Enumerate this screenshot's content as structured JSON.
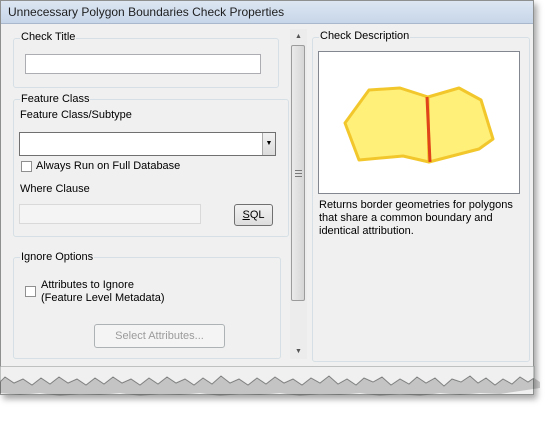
{
  "window": {
    "title": "Unnecessary Polygon Boundaries Check Properties"
  },
  "check_title": {
    "label": "Check Title",
    "value": ""
  },
  "feature_class": {
    "group_label": "Feature Class",
    "subtype_label": "Feature Class/Subtype",
    "selected": "",
    "dropdown_icon": "chevron-down-icon",
    "always_run_label": "Always Run on Full Database",
    "always_run_checked": false,
    "where_label": "Where Clause",
    "where_value": "",
    "sql_button": "SQL"
  },
  "ignore_options": {
    "group_label": "Ignore Options",
    "attributes_label_line1": "Attributes to Ignore",
    "attributes_label_line2": "(Feature Level Metadata)",
    "attributes_checked": false,
    "select_button": "Select Attributes..."
  },
  "description": {
    "group_label": "Check Description",
    "text": "Returns border geometries for polygons that share a common boundary and identical attribution.",
    "polygon_fill": "#fff07a",
    "polygon_stroke": "#f2c72c",
    "boundary_color": "#e0421a"
  },
  "colors": {
    "title_bar": "#c7d6e9",
    "dialog_background": "#f0f0f0"
  }
}
